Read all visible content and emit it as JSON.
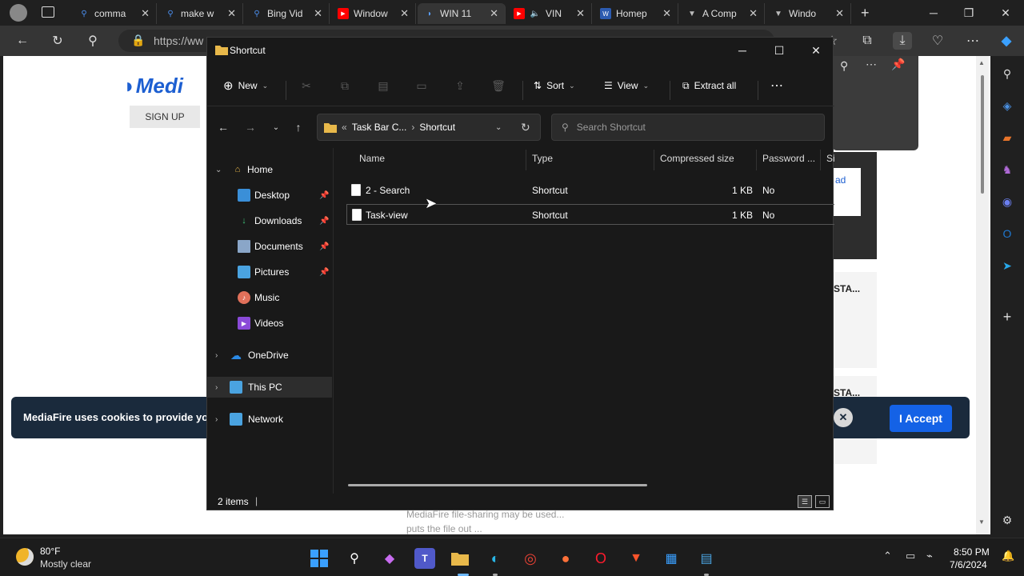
{
  "browser": {
    "tabs": [
      {
        "label": "comma",
        "icon": "search-icon",
        "color": "#4a8ff0"
      },
      {
        "label": "make w",
        "icon": "search-icon",
        "color": "#4a8ff0"
      },
      {
        "label": "Bing Vid",
        "icon": "search-icon",
        "color": "#4a8ff0"
      },
      {
        "label": "Window",
        "icon": "youtube-icon",
        "color": "#ff0000"
      },
      {
        "label": "WIN 11",
        "icon": "mediafire-icon",
        "color": "#1d5fd1"
      },
      {
        "label": "VIN",
        "icon": "youtube-icon",
        "color": "#ff0000"
      },
      {
        "label": "Homep",
        "icon": "site-icon",
        "color": "#2c5bb0"
      },
      {
        "label": "A Comp",
        "icon": "site-icon",
        "color": "#bbbbbb"
      },
      {
        "label": "Windo",
        "icon": "site-icon",
        "color": "#bbbbbb"
      }
    ],
    "url": "https://ww"
  },
  "webpage": {
    "logo": "Medi",
    "signup": "SIGN UP",
    "ad_button": "ad",
    "right_text_1": "STA...",
    "right_text_2": "STA...",
    "cookie_text": "MediaFire uses cookies to provide you w",
    "accept": "I Accept",
    "footer_line1": "MediaFire file-sharing may be used...",
    "footer_line2": "puts the file out ..."
  },
  "explorer": {
    "title": "Shortcut",
    "cmd": {
      "new": "New",
      "sort": "Sort",
      "view": "View",
      "extract": "Extract all"
    },
    "breadcrumb": {
      "prefix": "«",
      "parent": "Task Bar C...",
      "current": "Shortcut"
    },
    "search_placeholder": "Search Shortcut",
    "nav": {
      "home": "Home",
      "desktop": "Desktop",
      "downloads": "Downloads",
      "documents": "Documents",
      "pictures": "Pictures",
      "music": "Music",
      "videos": "Videos",
      "onedrive": "OneDrive",
      "thispc": "This PC",
      "network": "Network"
    },
    "columns": {
      "name": "Name",
      "type": "Type",
      "compressed": "Compressed size",
      "password": "Password ...",
      "size": "Si"
    },
    "files": [
      {
        "name": "2 - Search",
        "type": "Shortcut",
        "compressed": "1 KB",
        "password": "No"
      },
      {
        "name": "Task-view",
        "type": "Shortcut",
        "compressed": "1 KB",
        "password": "No"
      }
    ],
    "status": "2 items"
  },
  "taskbar": {
    "temp": "80°F",
    "weather": "Mostly clear",
    "time": "8:50 PM",
    "date": "7/6/2024"
  }
}
